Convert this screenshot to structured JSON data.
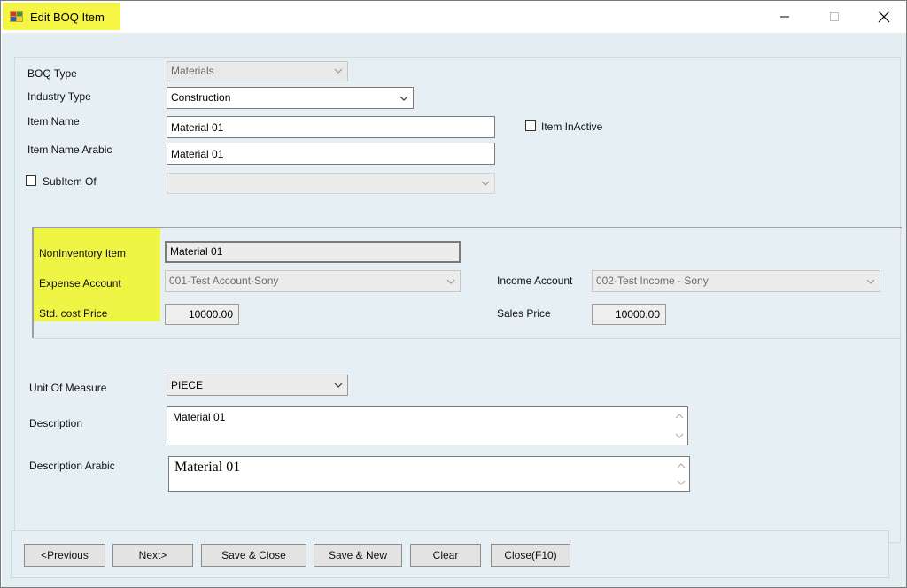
{
  "window": {
    "title": "Edit BOQ Item",
    "icon": "app-icon",
    "controls": [
      "minimize-icon",
      "maximize-icon",
      "close-icon"
    ]
  },
  "form": {
    "boq_type": {
      "label": "BOQ Type",
      "value": "Materials"
    },
    "industry_type": {
      "label": "Industry Type",
      "value": "Construction"
    },
    "item_name": {
      "label": "Item Name",
      "value": "Material 01"
    },
    "item_name_arabic": {
      "label": "Item Name Arabic",
      "value": "Material 01"
    },
    "item_inactive": {
      "label": "Item InActive",
      "checked": false
    },
    "subitem_of": {
      "label": "SubItem Of",
      "checked": false,
      "value": ""
    }
  },
  "account_section": {
    "noninventory_item": {
      "label": "NonInventory Item",
      "value": "Material 01"
    },
    "expense_account": {
      "label": "Expense Account",
      "value": "001-Test Account-Sony"
    },
    "income_account": {
      "label": "Income Account",
      "value": "002-Test Income - Sony"
    },
    "std_cost_price": {
      "label": "Std. cost Price",
      "value": "10000.00"
    },
    "sales_price": {
      "label": "Sales Price",
      "value": "10000.00"
    }
  },
  "details": {
    "unit_of_measure": {
      "label": "Unit Of Measure",
      "value": "PIECE"
    },
    "description": {
      "label": "Description",
      "value": "Material 01"
    },
    "description_arabic": {
      "label": "Description Arabic",
      "value": "Material 01"
    }
  },
  "buttons": {
    "previous": "<Previous",
    "next": "Next>",
    "save_close": "Save & Close",
    "save_new": "Save & New",
    "clear": "Clear",
    "close": "Close(F10)"
  },
  "colors": {
    "highlight": "#f5f545",
    "client_bg": "#e4edf1",
    "button_bg": "#e3e3e3"
  }
}
